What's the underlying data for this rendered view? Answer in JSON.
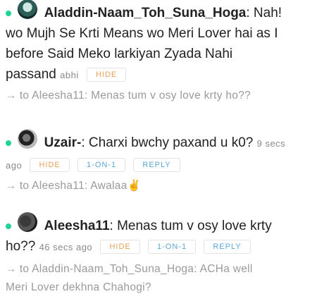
{
  "messages": [
    {
      "username": "Aladdin-Naam_Toh_Suna_Hoga",
      "text_line1": ": Nah!",
      "text_line2": "wo Mujh Se Krti Means wo Meri Lover hai as I",
      "text_line3": "before Said Meko larkiyan Zyada Nahi",
      "text_line4": "passand",
      "time": "abhi",
      "hide_label": "HIDE",
      "reply_to": "to Aleesha11: Menas tum v osy love krty ho??"
    },
    {
      "username": "Uzair-",
      "text_line1": ": Charxi bwchy paxand u k0?",
      "time_part1": "9 secs",
      "time_part2": "ago",
      "hide_label": "HIDE",
      "one_on_one_label": "1-ON-1",
      "reply_label": "REPLY",
      "reply_to": "to Aleesha11: Awalaa✌"
    },
    {
      "username": "Aleesha11",
      "text_line1": ": Menas tum v osy love krty",
      "text_line2": "ho??",
      "time": "46 secs ago",
      "hide_label": "HIDE",
      "one_on_one_label": "1-ON-1",
      "reply_label": "REPLY",
      "reply_to_line1": "to Aladdin-Naam_Toh_Suna_Hoga: ACHa well",
      "reply_to_line2": "Meri Lover dekhna Chahogi?"
    }
  ],
  "colors": {
    "online_dot": "#1fd39a",
    "hide_button": "#e8a05a",
    "action_button": "#5aa7d8",
    "reply_text": "#9a9a9a"
  },
  "icons": {
    "online": "online-status-dot-icon",
    "reply_arrow": "arrow-right-icon"
  }
}
